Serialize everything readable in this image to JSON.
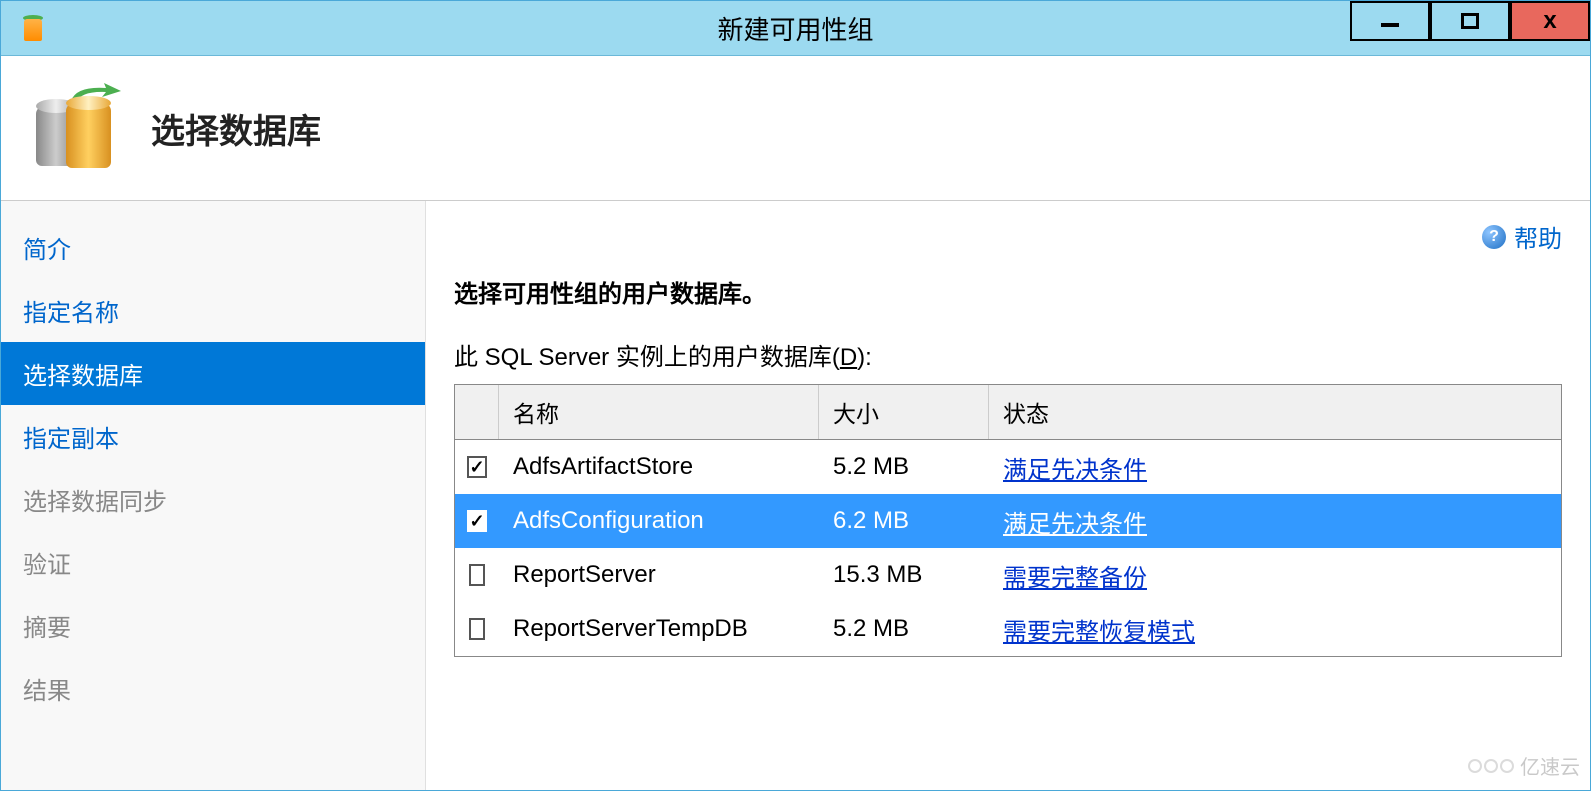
{
  "window": {
    "title": "新建可用性组"
  },
  "header": {
    "title": "选择数据库"
  },
  "help": {
    "label": "帮助"
  },
  "sidebar": {
    "items": [
      {
        "label": "简介",
        "state": "link"
      },
      {
        "label": "指定名称",
        "state": "link"
      },
      {
        "label": "选择数据库",
        "state": "active"
      },
      {
        "label": "指定副本",
        "state": "link"
      },
      {
        "label": "选择数据同步",
        "state": "disabled"
      },
      {
        "label": "验证",
        "state": "disabled"
      },
      {
        "label": "摘要",
        "state": "disabled"
      },
      {
        "label": "结果",
        "state": "disabled"
      }
    ]
  },
  "main": {
    "section_title": "选择可用性组的用户数据库。",
    "table_label_prefix": "此 SQL Server 实例上的用户数据库(",
    "table_label_key": "D",
    "table_label_suffix": "):",
    "columns": {
      "name": "名称",
      "size": "大小",
      "status": "状态"
    },
    "rows": [
      {
        "checked": true,
        "selected": false,
        "name": "AdfsArtifactStore",
        "size": "5.2 MB",
        "status": "满足先决条件"
      },
      {
        "checked": true,
        "selected": true,
        "name": "AdfsConfiguration",
        "size": "6.2 MB",
        "status": "满足先决条件"
      },
      {
        "checked": false,
        "selected": false,
        "name": "ReportServer",
        "size": "15.3 MB",
        "status": "需要完整备份"
      },
      {
        "checked": false,
        "selected": false,
        "name": "ReportServerTempDB",
        "size": "5.2 MB",
        "status": "需要完整恢复模式"
      }
    ]
  },
  "watermark": {
    "text": "亿速云"
  }
}
